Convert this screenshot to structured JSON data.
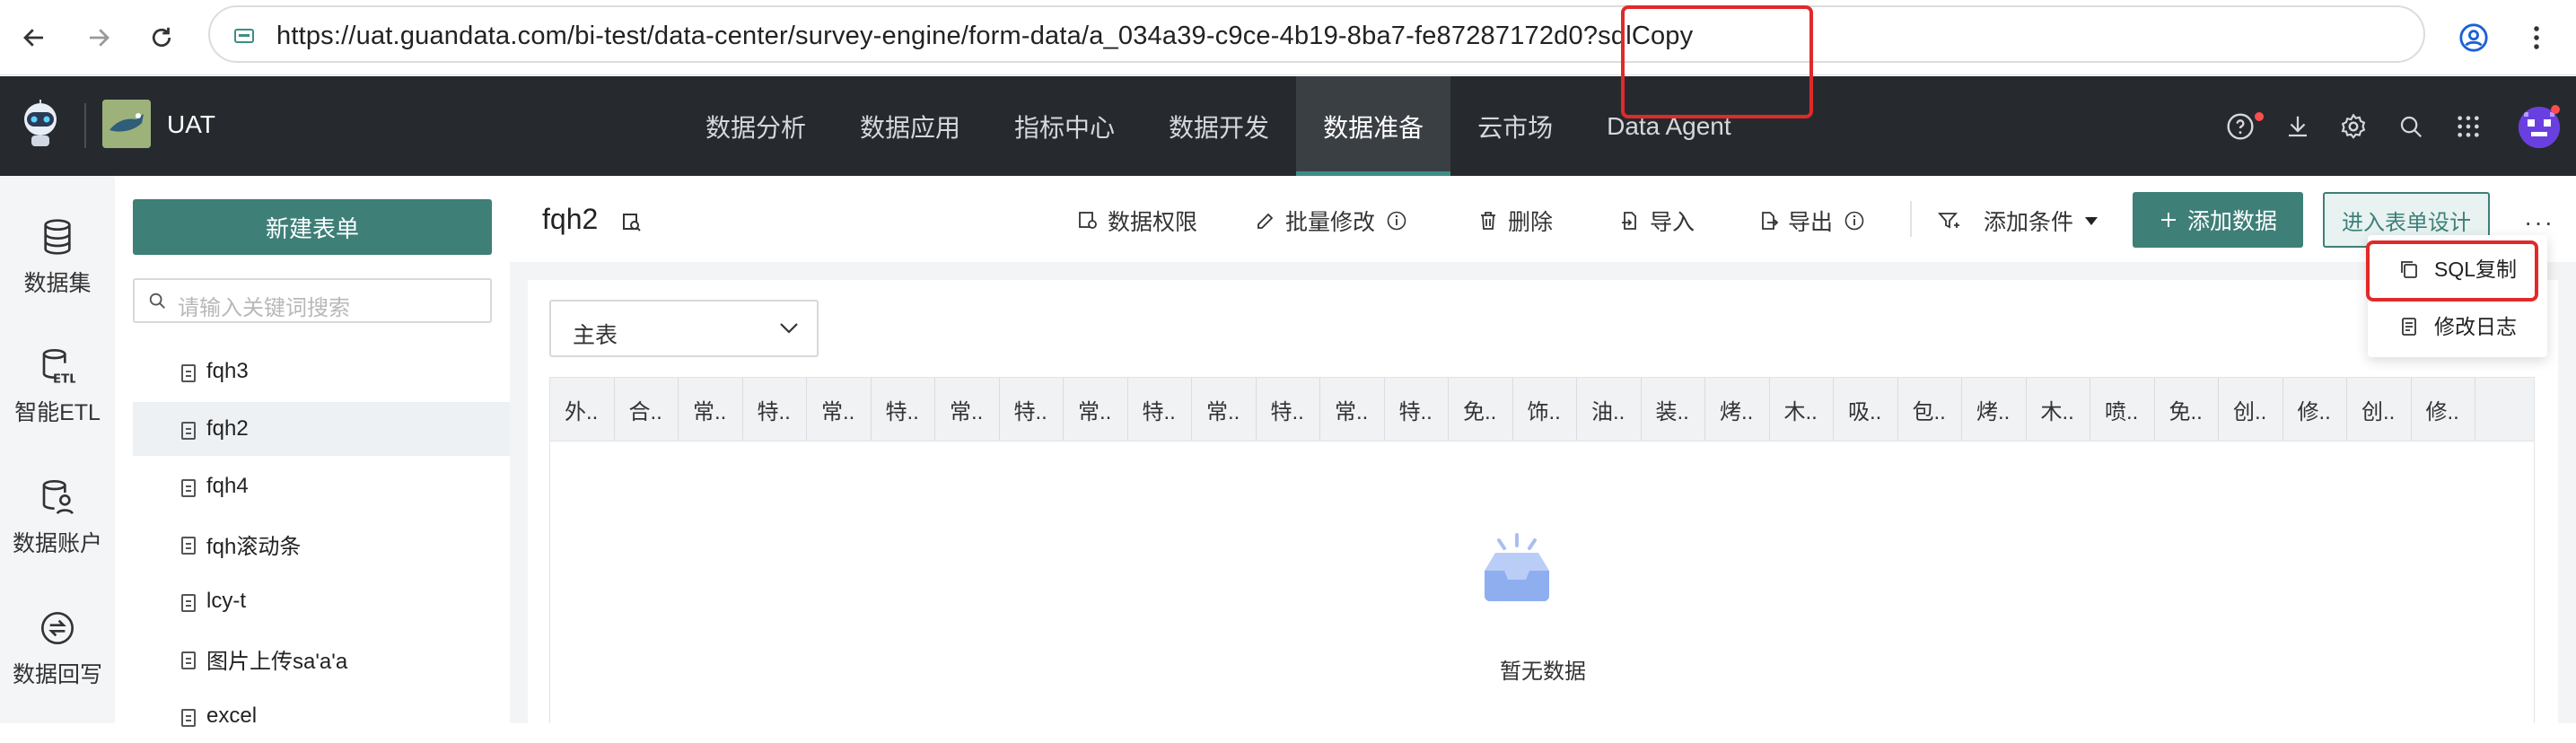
{
  "browser": {
    "url": "https://uat.guandata.com/bi-test/data-center/survey-engine/form-data/a_034a39-c9ce-4b19-8ba7-fe87287172d0?sqlCopy"
  },
  "header": {
    "app_name": "UAT",
    "nav": [
      "数据分析",
      "数据应用",
      "指标中心",
      "数据开发",
      "数据准备",
      "云市场",
      "Data Agent"
    ],
    "active_nav": "数据准备"
  },
  "rail": {
    "items": [
      {
        "label": "数据集",
        "icon": "database-icon"
      },
      {
        "label": "智能ETL",
        "icon": "etl-icon"
      },
      {
        "label": "数据账户",
        "icon": "data-account-icon"
      },
      {
        "label": "数据回写",
        "icon": "data-writeback-icon"
      }
    ]
  },
  "form_panel": {
    "new_button": "新建表单",
    "search_placeholder": "请输入关键词搜索",
    "items": [
      "fqh3",
      "fqh2",
      "fqh4",
      "fqh滚动条",
      "lcy-t",
      "图片上传sa'a'a",
      "excel"
    ],
    "selected": "fqh2"
  },
  "toolbar": {
    "title": "fqh2",
    "permissions": "数据权限",
    "batch_edit": "批量修改",
    "delete": "删除",
    "import": "导入",
    "export": "导出",
    "add_condition": "添加条件",
    "add_data": "添加数据",
    "enter_design": "进入表单设计",
    "more": "···"
  },
  "content": {
    "table_select_value": "主表",
    "columns": [
      "外..",
      "合..",
      "常..",
      "特..",
      "常..",
      "特..",
      "常..",
      "特..",
      "常..",
      "特..",
      "常..",
      "特..",
      "常..",
      "特..",
      "免..",
      "饰..",
      "油..",
      "装..",
      "烤..",
      "木..",
      "吸..",
      "包..",
      "烤..",
      "木..",
      "喷..",
      "免..",
      "创..",
      "修..",
      "创..",
      "修.."
    ],
    "empty_text": "暂无数据"
  },
  "dropdown": {
    "items": [
      {
        "label": "SQL复制",
        "icon": "copy-icon"
      },
      {
        "label": "修改日志",
        "icon": "log-icon"
      }
    ]
  },
  "colors": {
    "header_bg": "#262a2e",
    "accent": "#3e7f78",
    "highlight": "#e02a2a"
  }
}
